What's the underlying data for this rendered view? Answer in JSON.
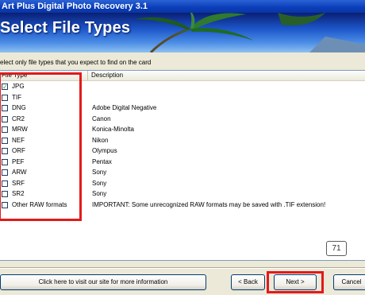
{
  "window": {
    "title": "Art Plus Digital Photo Recovery 3.1"
  },
  "banner": {
    "title": "Select File Types"
  },
  "instruction": "elect only file types that you expect to find on the card",
  "list": {
    "columns": {
      "type": "File Type",
      "description": "Description"
    },
    "rows": [
      {
        "type": "JPG",
        "description": "",
        "checked": true
      },
      {
        "type": "TIF",
        "description": "",
        "checked": false
      },
      {
        "type": "DNG",
        "description": "Adobe Digital Negative",
        "checked": false
      },
      {
        "type": "CR2",
        "description": "Canon",
        "checked": false
      },
      {
        "type": "MRW",
        "description": "Konica-Minolta",
        "checked": false
      },
      {
        "type": "NEF",
        "description": "Nikon",
        "checked": false
      },
      {
        "type": "ORF",
        "description": "Olympus",
        "checked": false
      },
      {
        "type": "PEF",
        "description": "Pentax",
        "checked": false
      },
      {
        "type": "ARW",
        "description": "Sony",
        "checked": false
      },
      {
        "type": "SRF",
        "description": "Sony",
        "checked": false
      },
      {
        "type": "SR2",
        "description": "Sony",
        "checked": false
      },
      {
        "type": "Other RAW formats",
        "description": "IMPORTANT: Some unrecognized RAW formats may be saved with .TIF extension!",
        "checked": false
      }
    ]
  },
  "badge": "71",
  "buttons": {
    "site": "Click here to visit our site for more information",
    "back": "< Back",
    "next": "Next >",
    "cancel": "Cancel"
  },
  "colors": {
    "highlight": "#e21a1a",
    "checkmark": "#21a121",
    "titlebar": "#0a3db8"
  }
}
